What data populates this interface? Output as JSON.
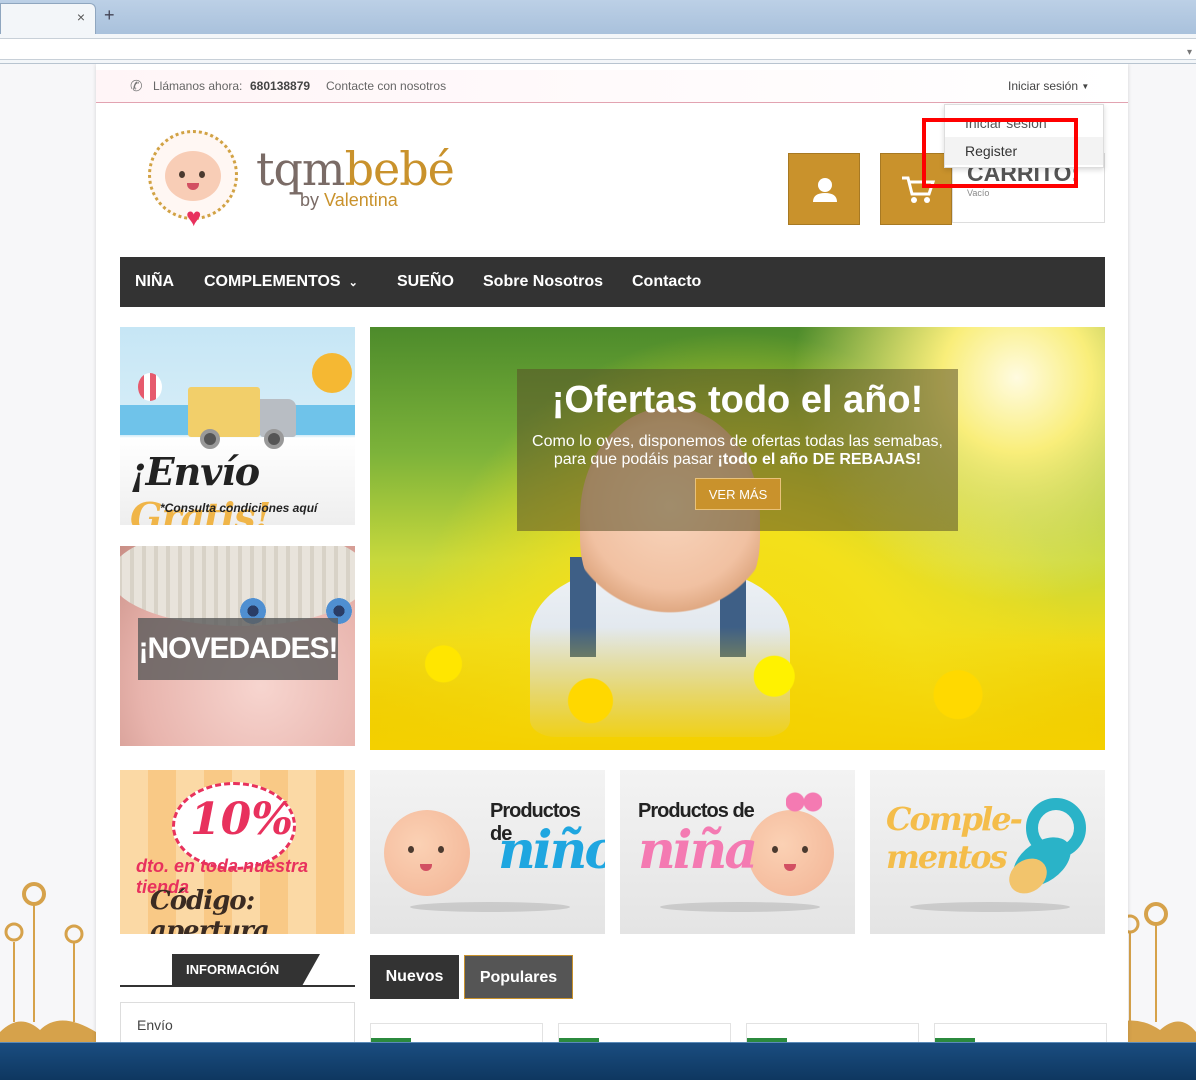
{
  "browser": {
    "tab_close_glyph": "×",
    "new_tab_glyph": "+",
    "address_dropdown_glyph": "▾"
  },
  "topbar": {
    "call_label": "Llámanos ahora:",
    "phone_number": "680138879",
    "contact_link": "Contacte con nosotros",
    "login_toggle": "Iniciar sesión"
  },
  "account_dropdown": {
    "items": [
      {
        "label": "Iniciar sesión"
      },
      {
        "label": "Register"
      }
    ]
  },
  "header": {
    "brand_part1": "tqm",
    "brand_part2": "bebé",
    "brand_by": "by",
    "brand_name": "Valentina",
    "cart_title": "CARRITO:",
    "cart_status": "Vacío"
  },
  "nav": {
    "items": [
      {
        "label": "NIÑA"
      },
      {
        "label": "COMPLEMENTOS"
      },
      {
        "label": "SUEÑO"
      },
      {
        "label": "Sobre Nosotros"
      },
      {
        "label": "Contacto"
      }
    ]
  },
  "banners": {
    "envio_part1": "¡Envío",
    "envio_part2": "Gratis!",
    "envio_sub": "*Consulta condiciones aquí",
    "novedades": "¡NOVEDADES!",
    "promo_pct": "10%",
    "promo_line1": "dto. en toda nuestra tienda",
    "promo_line2": "Código: apertura"
  },
  "hero": {
    "title": "¡Ofertas todo el año!",
    "text_line1": "Como lo oyes, disponemos de ofertas todas las semabas,",
    "text_line2_plain": "para que podáis pasar ",
    "text_line2_bold": "¡todo el año DE REBAJAS!",
    "button": "VER MÁS"
  },
  "tiles": {
    "nino_line1": "Productos de",
    "nino_line2": "niño",
    "nina_line1": "Productos de",
    "nina_line2": "niña",
    "compl_line1": "Comple-",
    "compl_line2": "mentos"
  },
  "info": {
    "heading": "INFORMACIÓN",
    "items": [
      {
        "label": "Envío"
      }
    ]
  },
  "product_tabs": {
    "nuevos": "Nuevos",
    "populares": "Populares"
  },
  "colors": {
    "accent": "#c9922c",
    "nav_bg": "#333333",
    "highlight": "#ff0000",
    "pink": "#e8315d"
  }
}
